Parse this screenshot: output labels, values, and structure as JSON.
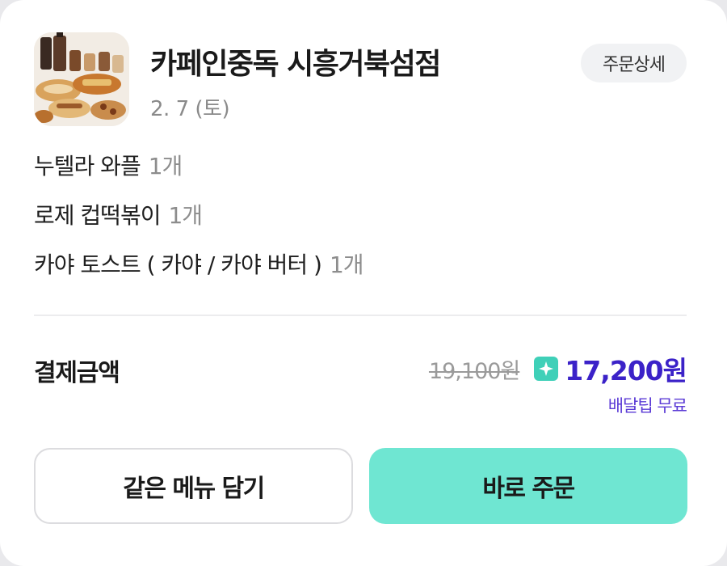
{
  "store": {
    "name": "카페인중독 시흥거북섬점",
    "date": "2. 7 (토)",
    "detail_label": "주문상세"
  },
  "items": [
    {
      "name": "누텔라 와플",
      "qty": "1개"
    },
    {
      "name": "로제 컵떡볶이",
      "qty": "1개"
    },
    {
      "name": "카야 토스트 ( 카야 / 카야 버터 )",
      "qty": "1개"
    }
  ],
  "payment": {
    "label": "결제금액",
    "original_price": "19,100원",
    "final_price": "17,200원",
    "delivery_note": "배달팁 무료"
  },
  "actions": {
    "same_menu_label": "같은 메뉴 담기",
    "order_now_label": "바로 주문"
  },
  "colors": {
    "accent_mint": "#6fe6d2",
    "price_purple": "#3b22c8",
    "badge_teal": "#3fd0b8"
  },
  "icons": {
    "store_thumbnail": "store-photo",
    "price_badge": "sparkle-star-icon"
  }
}
